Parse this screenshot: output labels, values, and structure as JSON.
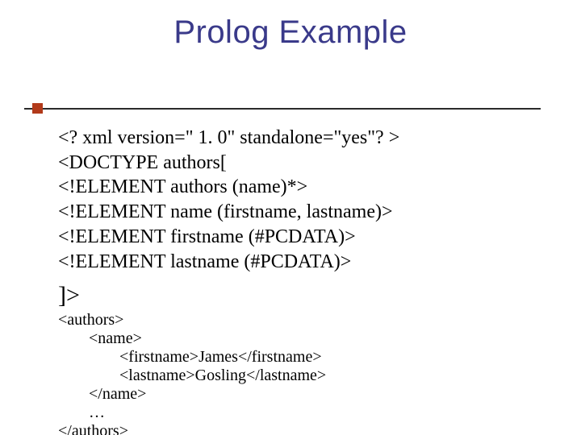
{
  "title": "Prolog Example",
  "dtd": {
    "l1": "<? xml version=\" 1. 0\" standalone=\"yes\"? >",
    "l2": "<DOCTYPE authors[",
    "l3": "<!ELEMENT authors (name)*>",
    "l4": "<!ELEMENT name (firstname, lastname)>",
    "l5": "<!ELEMENT firstname (#PCDATA)>",
    "l6": "<!ELEMENT lastname (#PCDATA)>",
    "l7": "]>"
  },
  "xml": {
    "l1": "<authors>",
    "l2": "<name>",
    "l3": "<firstname>James</firstname>",
    "l4": "<lastname>Gosling</lastname>",
    "l5": "</name>",
    "l6": "…",
    "l7": "</authors>"
  }
}
